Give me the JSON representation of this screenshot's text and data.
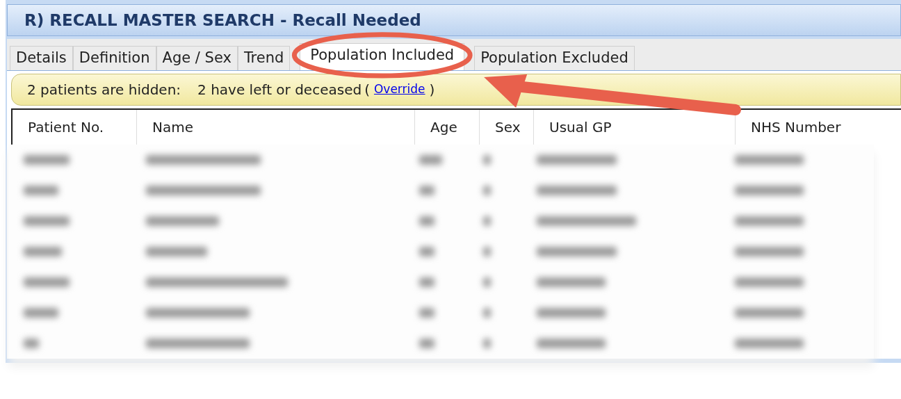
{
  "window": {
    "title": "R) RECALL MASTER SEARCH - Recall Needed"
  },
  "tabs": [
    {
      "label": "Details",
      "selected": false
    },
    {
      "label": "Definition",
      "selected": false
    },
    {
      "label": "Age / Sex",
      "selected": false
    },
    {
      "label": "Trend",
      "selected": false
    },
    {
      "label": "Population Included",
      "selected": true
    },
    {
      "label": "Population Excluded",
      "selected": false
    }
  ],
  "banner": {
    "hidden_text": "2 patients are hidden:",
    "reason_text": "2 have left or deceased",
    "open_paren": "(",
    "link": "Override",
    "close_paren": ")"
  },
  "table": {
    "columns": [
      "Patient No.",
      "Name",
      "Age",
      "Sex",
      "Usual GP",
      "NHS Number"
    ],
    "rows": [
      {
        "blurred": true
      },
      {
        "blurred": true
      },
      {
        "blurred": true
      },
      {
        "blurred": true
      },
      {
        "blurred": true
      },
      {
        "blurred": true
      },
      {
        "blurred": true
      }
    ]
  },
  "annotation": {
    "ellipse": true,
    "arrow": true
  }
}
